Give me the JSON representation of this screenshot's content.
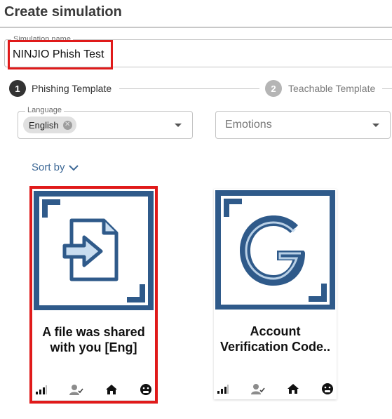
{
  "header": {
    "title": "Create simulation"
  },
  "simulation_name": {
    "label": "Simulation name",
    "value": "NINJIO Phish Test"
  },
  "stepper": {
    "steps": [
      {
        "number": "1",
        "label": "Phishing Template",
        "active": true
      },
      {
        "number": "2",
        "label": "Teachable Template",
        "active": false
      }
    ]
  },
  "filters": {
    "language": {
      "label": "Language",
      "selected_chip": "English"
    },
    "emotions": {
      "placeholder": "Emotions"
    }
  },
  "sort": {
    "label": "Sort by"
  },
  "cards": [
    {
      "title_line1": "A file was shared",
      "title_line2": "with you [Eng]",
      "icon": "file-share-icon",
      "selected": true
    },
    {
      "title_line1": "Account",
      "title_line2": "Verification Code..",
      "icon": "google-g-icon",
      "selected": false
    }
  ],
  "colors": {
    "accent": "#2f5a8a",
    "highlight": "#e01a1a",
    "link": "#3f6a97",
    "thumb_light": "#c9ddf0"
  }
}
